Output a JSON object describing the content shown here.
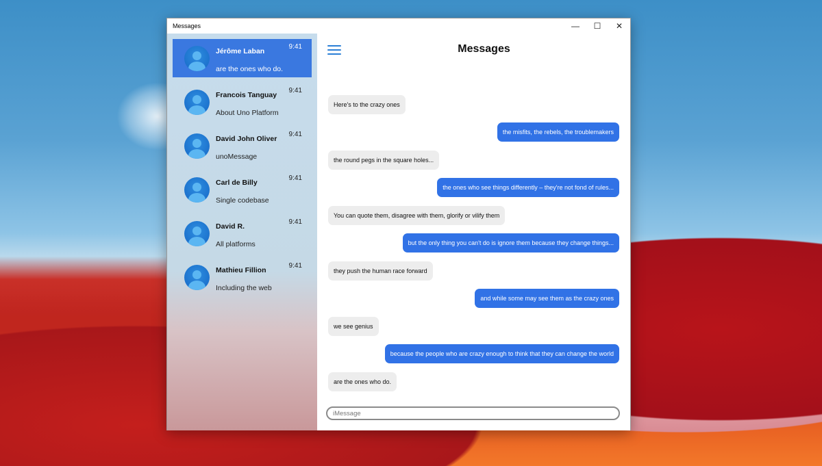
{
  "window": {
    "title": "Messages",
    "minimize": "—",
    "maximize": "☐",
    "close": "✕"
  },
  "contacts": [
    {
      "name": "Jérôme Laban",
      "preview": "are the ones who do.",
      "time": "9:41",
      "selected": true
    },
    {
      "name": "Francois Tanguay",
      "preview": "About Uno Platform",
      "time": "9:41"
    },
    {
      "name": "David John Oliver",
      "preview": "unoMessage",
      "time": "9:41"
    },
    {
      "name": "Carl de Billy",
      "preview": "Single codebase",
      "time": "9:41"
    },
    {
      "name": "David R.",
      "preview": "All platforms",
      "time": "9:41"
    },
    {
      "name": "Mathieu Fillion",
      "preview": "Including the web",
      "time": "9:41"
    }
  ],
  "header": {
    "title": "Messages"
  },
  "messages": [
    {
      "dir": "in",
      "text": "Here's to the crazy ones"
    },
    {
      "dir": "out",
      "text": "the misfits, the rebels, the troublemakers"
    },
    {
      "dir": "in",
      "text": "the round pegs in the square holes..."
    },
    {
      "dir": "out",
      "text": "the ones who see things differently – they're not fond of rules..."
    },
    {
      "dir": "in",
      "text": "You can quote them, disagree with them, glorify or vilify them"
    },
    {
      "dir": "out",
      "text": "but the only thing you can't do is ignore them because they change things..."
    },
    {
      "dir": "in",
      "text": "they push the human race forward"
    },
    {
      "dir": "out",
      "text": "and while some may see them as the crazy ones"
    },
    {
      "dir": "in",
      "text": "we see genius"
    },
    {
      "dir": "out",
      "text": "because the people who are crazy enough to think that they can change the world"
    },
    {
      "dir": "in",
      "text": "are the ones who do."
    }
  ],
  "composer": {
    "placeholder": "iMessage",
    "value": ""
  },
  "colors": {
    "accent": "#3172e6",
    "selected": "#3a78e0",
    "incoming": "#ededed"
  }
}
